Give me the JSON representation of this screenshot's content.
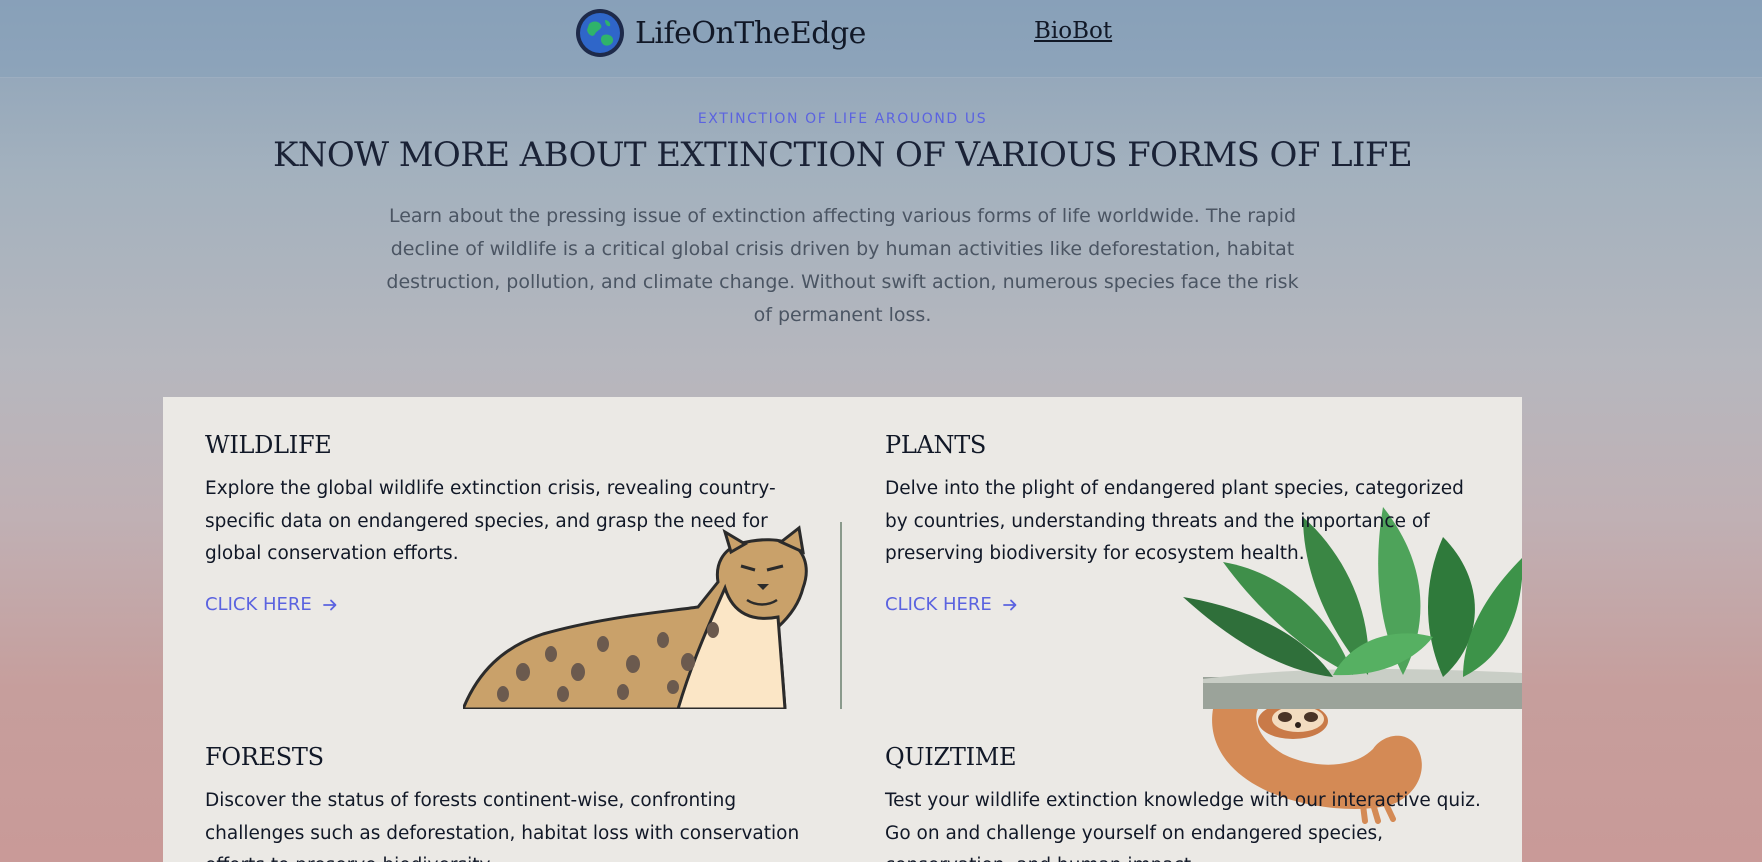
{
  "navbar": {
    "brand_name": "LifeOnTheEdge",
    "nav_link": "BioBot"
  },
  "hero": {
    "kicker": "EXTINCTION OF LIFE AROUOND US",
    "title": "KNOW MORE ABOUT EXTINCTION OF VARIOUS FORMS OF LIFE",
    "description": "Learn about the pressing issue of extinction affecting various forms of life worldwide. The rapid decline of wildlife is a critical global crisis driven by human activities like deforestation, habitat destruction, pollution, and climate change. Without swift action, numerous species face the risk of permanent loss."
  },
  "cards": [
    {
      "title": "WILDLIFE",
      "description": "Explore the global wildlife extinction crisis, revealing country-specific data on endangered species, and grasp the need for global conservation efforts.",
      "link": "CLICK HERE",
      "image_icon": "cheetah-illustration"
    },
    {
      "title": "PLANTS",
      "description": "Delve into the plight of endangered plant species, categorized by countries, understanding threats and the importance of preserving biodiversity for ecosystem health.",
      "link": "CLICK HERE",
      "image_icon": "succulent-plant-photo"
    },
    {
      "title": "FORESTS",
      "description": "Discover the status of forests continent-wise, confronting challenges such as deforestation, habitat loss with conservation efforts to preserve biodiversity."
    },
    {
      "title": "QUIZTIME",
      "description": "Test your wildlife extinction knowledge with our interactive quiz. Go on and challenge yourself on endangered species, conservation, and human impact.",
      "image_icon": "sloth-illustration"
    }
  ],
  "colors": {
    "accent": "#5b63e0",
    "heading": "#111827",
    "card_background": "#ebe9e5"
  }
}
